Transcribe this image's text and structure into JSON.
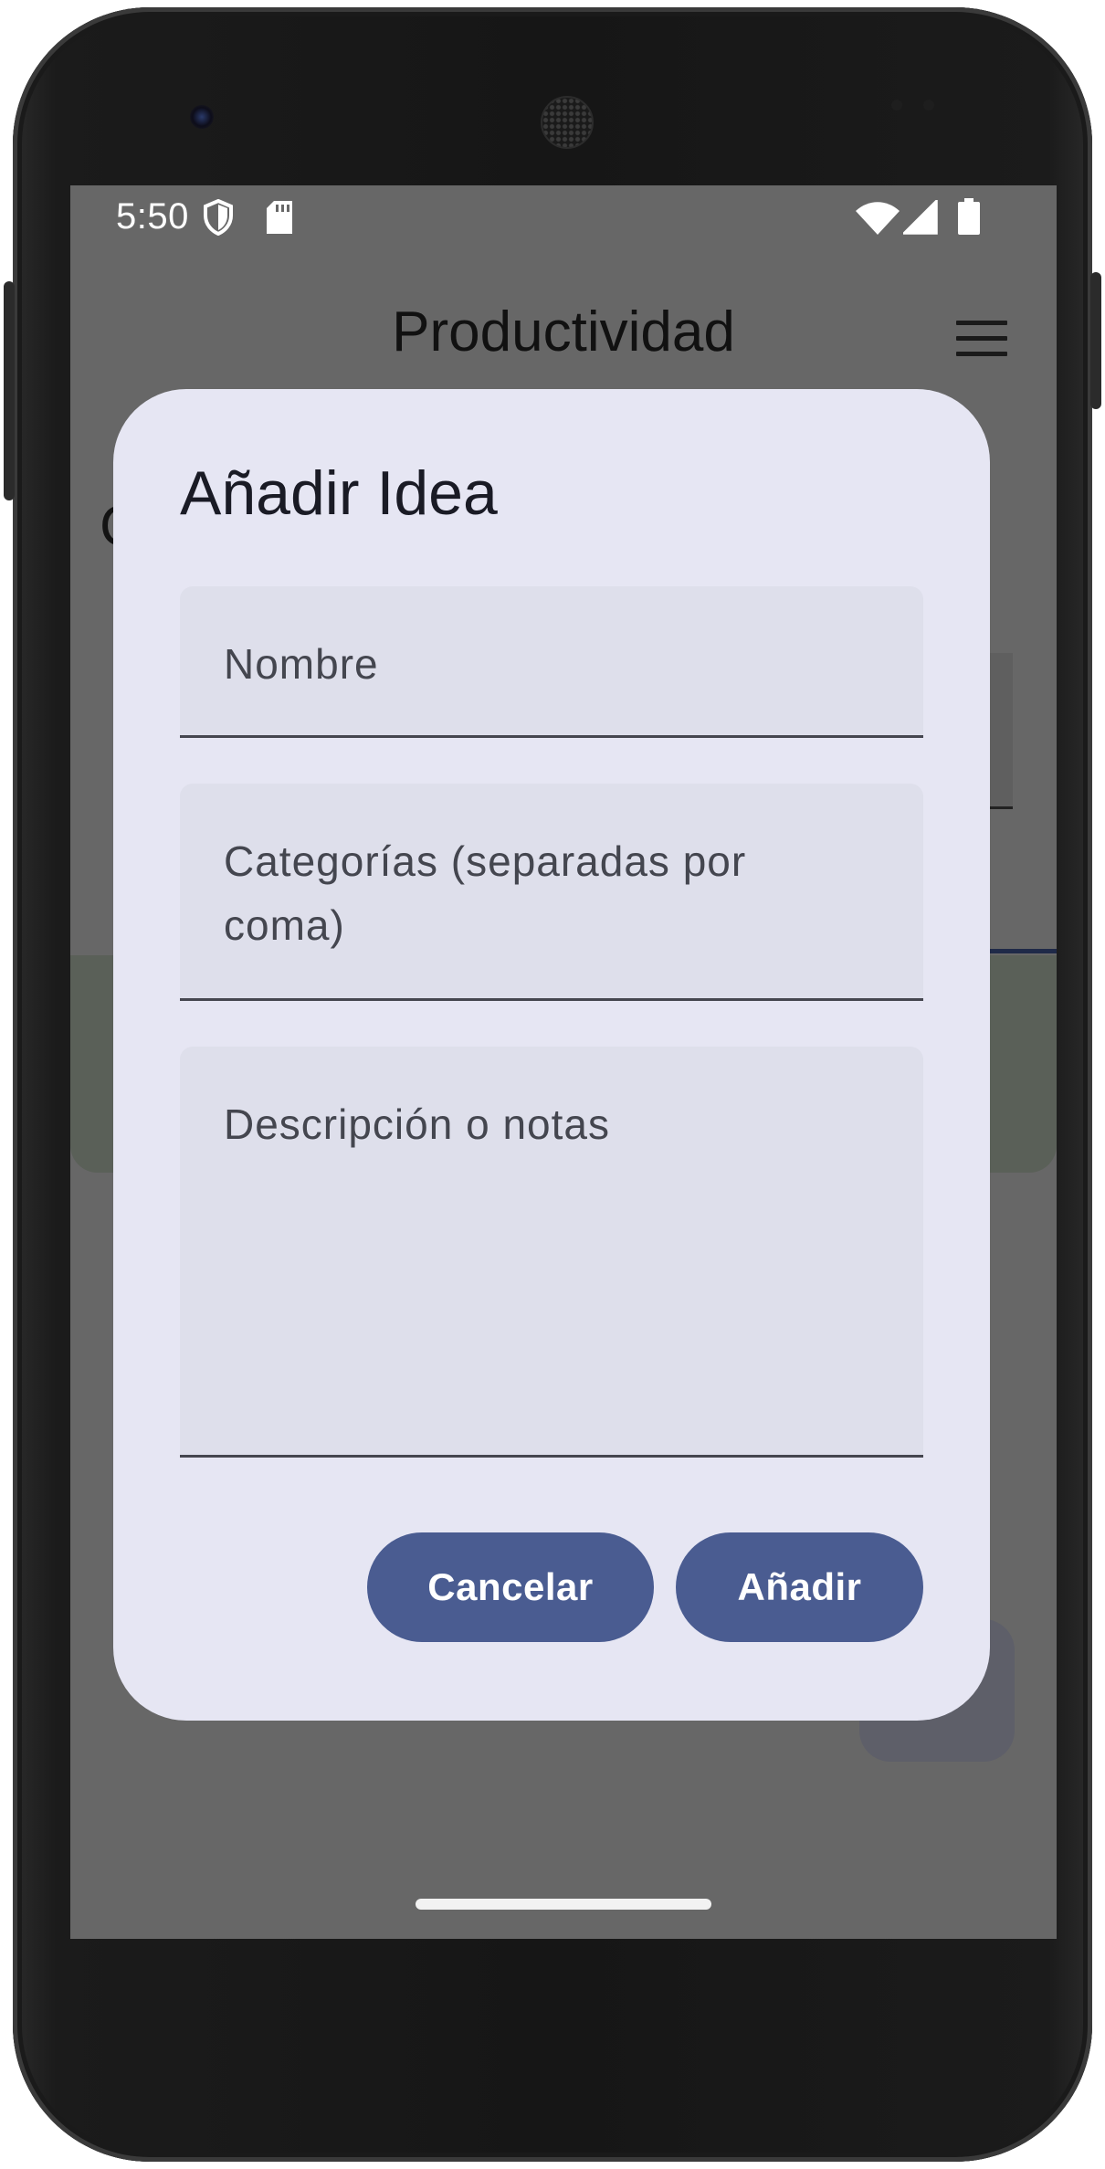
{
  "status_bar": {
    "time": "5:50",
    "icons": [
      "shield-icon",
      "sd-card-icon",
      "wifi-icon",
      "signal-icon",
      "battery-icon"
    ]
  },
  "app_bar": {
    "title": "Productividad",
    "menu_icon": "hamburger-menu-icon"
  },
  "background": {
    "heading_partial": "C"
  },
  "dialog": {
    "title": "Añadir Idea",
    "fields": {
      "name_placeholder": "Nombre",
      "categories_placeholder": "Categorías (separadas por coma)",
      "description_placeholder": "Descripción o notas"
    },
    "buttons": {
      "cancel_label": "Cancelar",
      "add_label": "Añadir"
    }
  },
  "colors": {
    "dialog_bg": "#e6e6f3",
    "field_bg": "#dedfeb",
    "button_bg": "#4a5c91",
    "scrim": "#676767"
  }
}
